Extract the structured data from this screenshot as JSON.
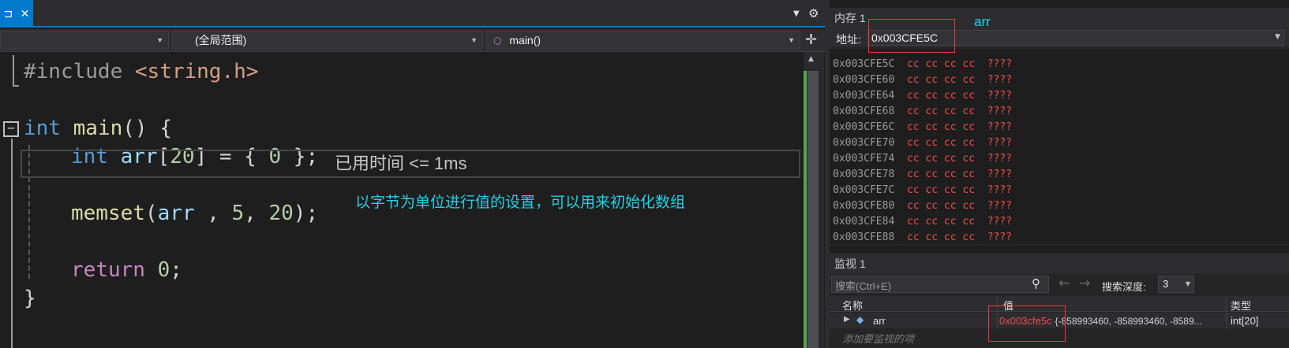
{
  "editor": {
    "tab_pin": "⊐",
    "tab_close": "✕",
    "scope_label": "(全局范围)",
    "function_label": "main()",
    "lines": {
      "l1_pre": "#include ",
      "l1_str": "<string.h>",
      "l2_kw": "int",
      "l2_fn": " main",
      "l2_rest": "() {",
      "l3_kw": "int",
      "l3_var": " arr",
      "l3_rest1": "[",
      "l3_num": "20",
      "l3_rest2": "] = { ",
      "l3_num2": "0",
      "l3_rest3": " };",
      "l4_fn": "memset",
      "l4_rest1": "(",
      "l4_var": "arr",
      "l4_rest2": " , ",
      "l4_num1": "5",
      "l4_rest3": ", ",
      "l4_num2": "20",
      "l4_rest4": ");",
      "l5_kw": "return",
      "l5_num": " 0",
      "l5_rest": ";",
      "l6": "}"
    },
    "elapsed_hint": "已用时间 <= 1ms",
    "annotation": "以字节为单位进行值的设置，可以用来初始化数组",
    "collapse_glyph": "−"
  },
  "memory": {
    "title": "内存 1",
    "annotation": "arr",
    "address_label": "地址:",
    "address_value": "0x003CFE5C",
    "rows": [
      {
        "addr": "0x003CFE5C",
        "bytes": "cc cc cc cc",
        "chars": "????"
      },
      {
        "addr": "0x003CFE60",
        "bytes": "cc cc cc cc",
        "chars": "????"
      },
      {
        "addr": "0x003CFE64",
        "bytes": "cc cc cc cc",
        "chars": "????"
      },
      {
        "addr": "0x003CFE68",
        "bytes": "cc cc cc cc",
        "chars": "????"
      },
      {
        "addr": "0x003CFE6C",
        "bytes": "cc cc cc cc",
        "chars": "????"
      },
      {
        "addr": "0x003CFE70",
        "bytes": "cc cc cc cc",
        "chars": "????"
      },
      {
        "addr": "0x003CFE74",
        "bytes": "cc cc cc cc",
        "chars": "????"
      },
      {
        "addr": "0x003CFE78",
        "bytes": "cc cc cc cc",
        "chars": "????"
      },
      {
        "addr": "0x003CFE7C",
        "bytes": "cc cc cc cc",
        "chars": "????"
      },
      {
        "addr": "0x003CFE80",
        "bytes": "cc cc cc cc",
        "chars": "????"
      },
      {
        "addr": "0x003CFE84",
        "bytes": "cc cc cc cc",
        "chars": "????"
      },
      {
        "addr": "0x003CFE88",
        "bytes": "cc cc cc cc",
        "chars": "????"
      }
    ]
  },
  "watch": {
    "title": "监视 1",
    "search_placeholder": "搜索(Ctrl+E)",
    "depth_label": "搜索深度:",
    "depth_value": "3",
    "columns": {
      "name": "名称",
      "value": "值",
      "type": "类型"
    },
    "row": {
      "name": "arr",
      "value_addr": "0x003cfe5c",
      "value_rest": "{-858993460, -858993460, -8589...",
      "type": "int[20]"
    },
    "add_item": "添加要监视的项"
  }
}
